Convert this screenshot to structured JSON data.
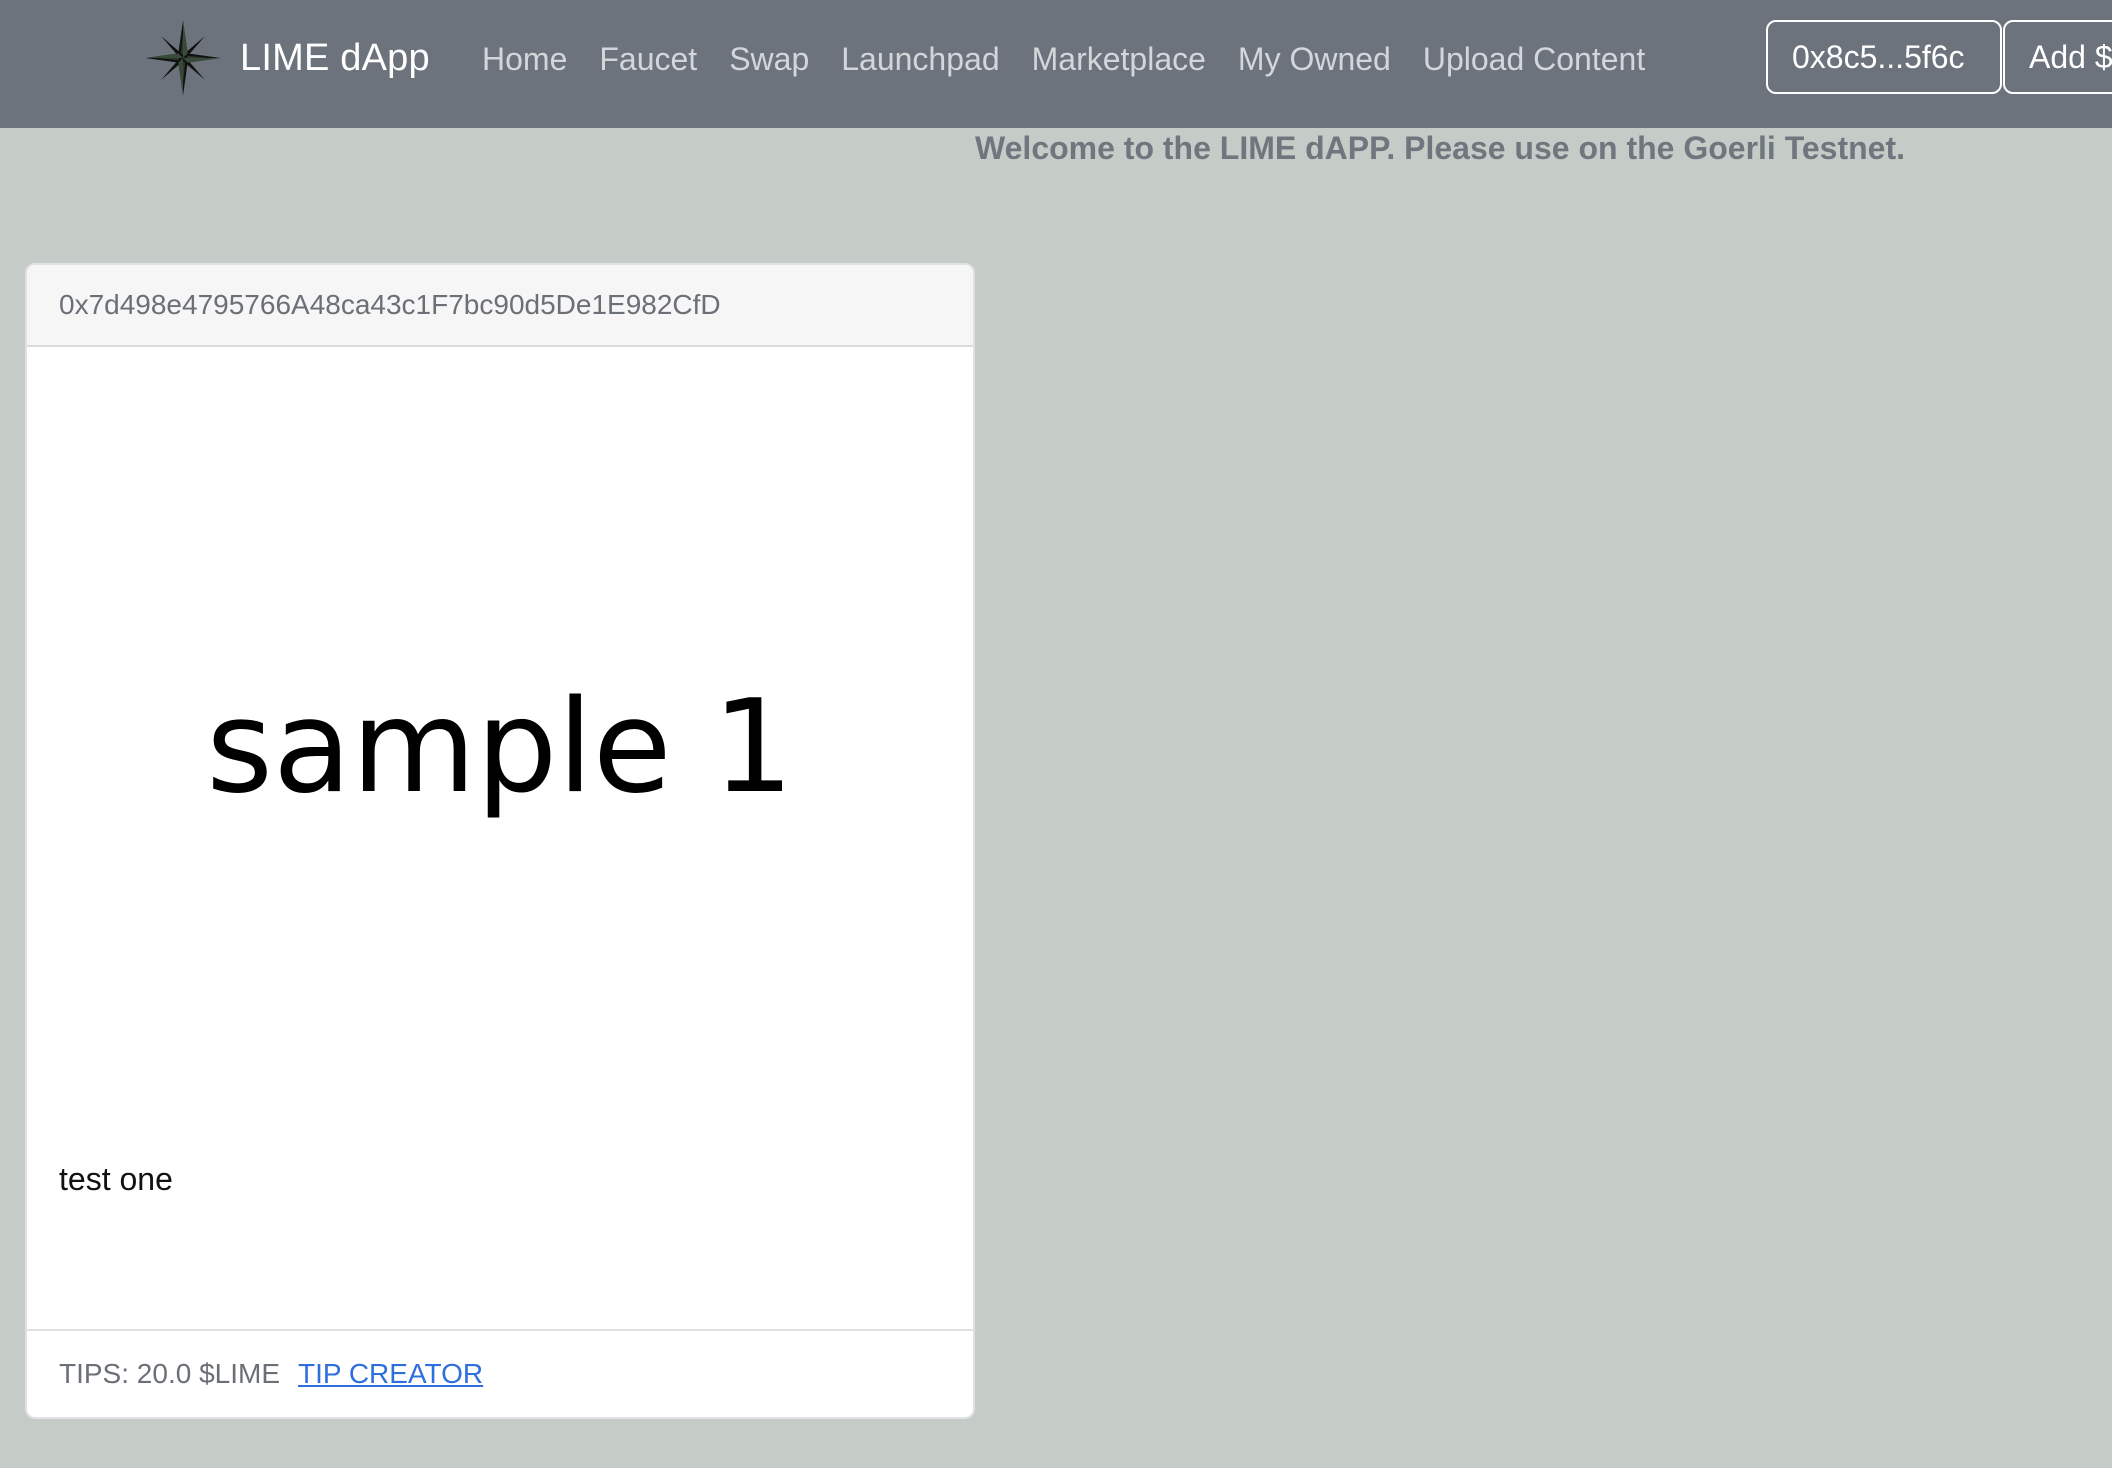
{
  "navbar": {
    "brand_name": "LIME dApp",
    "links": [
      {
        "label": "Home"
      },
      {
        "label": "Faucet"
      },
      {
        "label": "Swap"
      },
      {
        "label": "Launchpad"
      },
      {
        "label": "Marketplace"
      },
      {
        "label": "My Owned"
      },
      {
        "label": "Upload Content"
      }
    ],
    "wallet_button": "0x8c5...5f6c",
    "add_token_button": "Add $LIME"
  },
  "welcome_message": "Welcome to the LIME dAPP. Please use on the Goerli Testnet.",
  "content_card": {
    "creator_address": "0x7d498e4795766A48ca43c1F7bc90d5De1E982CfD",
    "image_text": "sample 1",
    "title": "test one",
    "tips_label": "TIPS: 20.0 $LIME",
    "tip_button": "TIP CREATOR"
  },
  "colors": {
    "navbar_bg": "#6c737c",
    "page_bg": "#c5ccc8",
    "link": "#2f6fdd"
  }
}
